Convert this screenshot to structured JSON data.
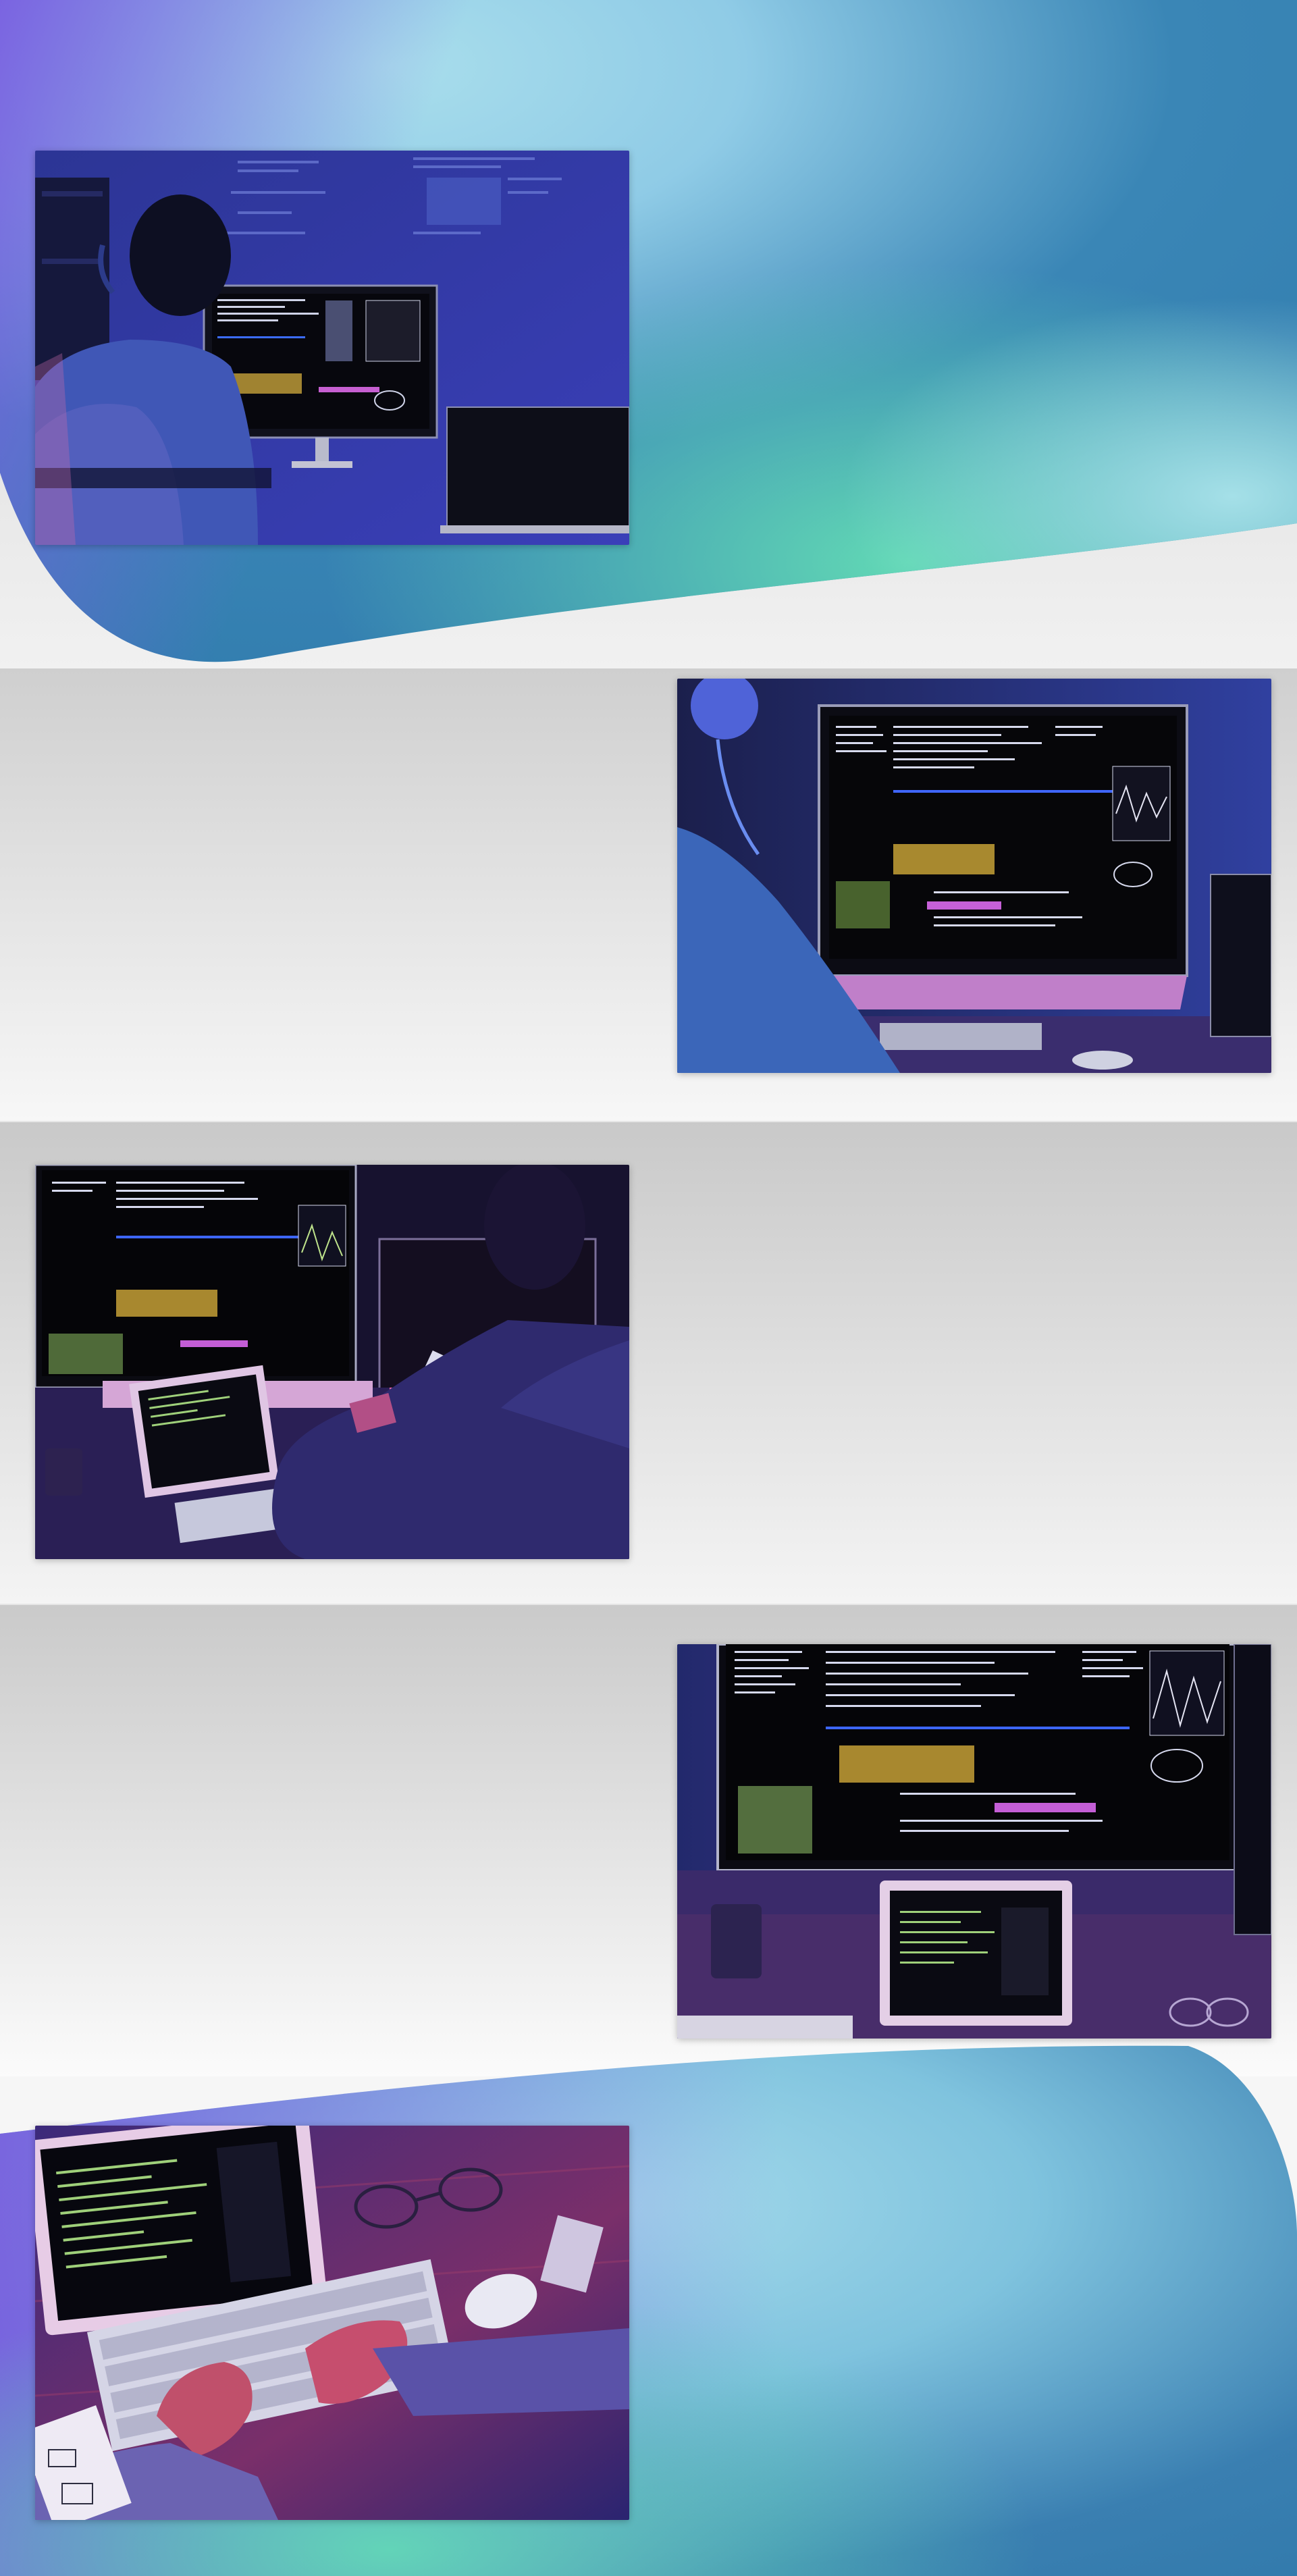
{
  "page": {
    "theme": {
      "gradient_purple": "#7b5ee0",
      "gradient_teal": "#5fd5b7",
      "gradient_blue": "#2f7db0",
      "gradient_light": "#a8dcea"
    }
  },
  "photos": [
    {
      "icon": "developer-at-monitor-photo",
      "alt": ""
    },
    {
      "icon": "developer-coding-closeup-photo",
      "alt": ""
    },
    {
      "icon": "developer-with-phone-photo",
      "alt": ""
    },
    {
      "icon": "monitor-and-tablet-code-photo",
      "alt": ""
    },
    {
      "icon": "hands-typing-keyboard-photo",
      "alt": ""
    }
  ]
}
